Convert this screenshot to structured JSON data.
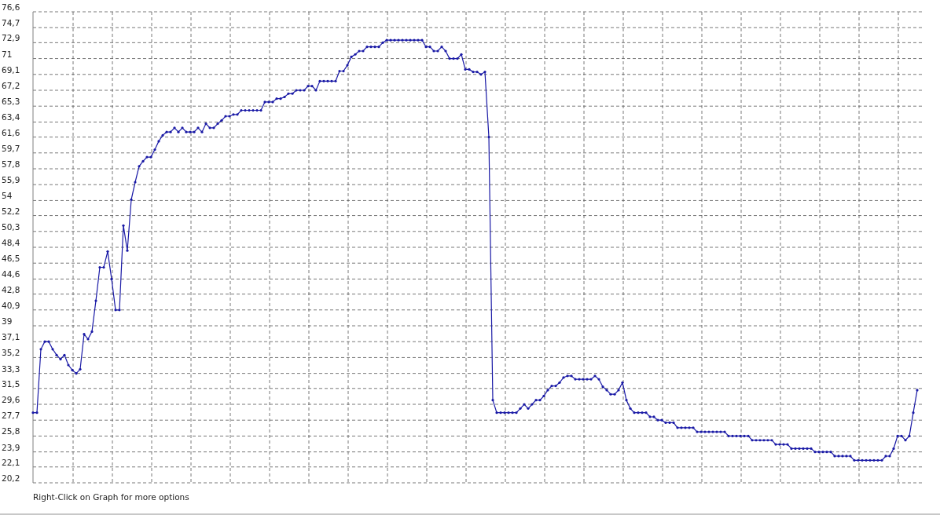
{
  "graph": {
    "chart_data": {
      "type": "line",
      "grid": true,
      "ylim": [
        20.2,
        76.6
      ],
      "yticks": [
        {
          "value": 76.6,
          "label": "76,6"
        },
        {
          "value": 74.7,
          "label": "74,7"
        },
        {
          "value": 72.9,
          "label": "72,9"
        },
        {
          "value": 71,
          "label": "71"
        },
        {
          "value": 69.1,
          "label": "69,1"
        },
        {
          "value": 67.2,
          "label": "67,2"
        },
        {
          "value": 65.3,
          "label": "65,3"
        },
        {
          "value": 63.4,
          "label": "63,4"
        },
        {
          "value": 61.6,
          "label": "61,6"
        },
        {
          "value": 59.7,
          "label": "59,7"
        },
        {
          "value": 57.8,
          "label": "57,8"
        },
        {
          "value": 55.9,
          "label": "55,9"
        },
        {
          "value": 54,
          "label": "54"
        },
        {
          "value": 52.2,
          "label": "52,2"
        },
        {
          "value": 50.3,
          "label": "50,3"
        },
        {
          "value": 48.4,
          "label": "48,4"
        },
        {
          "value": 46.5,
          "label": "46,5"
        },
        {
          "value": 44.6,
          "label": "44,6"
        },
        {
          "value": 42.8,
          "label": "42,8"
        },
        {
          "value": 40.9,
          "label": "40,9"
        },
        {
          "value": 39,
          "label": "39"
        },
        {
          "value": 37.1,
          "label": "37,1"
        },
        {
          "value": 35.2,
          "label": "35,2"
        },
        {
          "value": 33.3,
          "label": "33,3"
        },
        {
          "value": 31.5,
          "label": "31,5"
        },
        {
          "value": 29.6,
          "label": "29,6"
        },
        {
          "value": 27.7,
          "label": "27,7"
        },
        {
          "value": 25.8,
          "label": "25,8"
        },
        {
          "value": 23.9,
          "label": "23,9"
        },
        {
          "value": 22.1,
          "label": "22,1"
        },
        {
          "value": 20.2,
          "label": "20,2"
        }
      ],
      "series": [
        {
          "color": "#1a1aa6",
          "values": [
            28.6,
            28.6,
            36.2,
            37.1,
            37.1,
            36.2,
            35.5,
            35.0,
            35.5,
            34.3,
            33.7,
            33.3,
            33.8,
            38.0,
            37.4,
            38.3,
            42.0,
            46.0,
            46.0,
            47.9,
            44.6,
            40.9,
            40.9,
            51.0,
            48.0,
            54.1,
            56.2,
            58.1,
            58.7,
            59.2,
            59.2,
            60.1,
            61.1,
            61.8,
            62.2,
            62.2,
            62.7,
            62.2,
            62.7,
            62.2,
            62.2,
            62.2,
            62.7,
            62.2,
            63.2,
            62.7,
            62.7,
            63.2,
            63.6,
            64.1,
            64.1,
            64.3,
            64.3,
            64.8,
            64.8,
            64.8,
            64.8,
            64.8,
            64.8,
            65.8,
            65.8,
            65.8,
            66.2,
            66.2,
            66.4,
            66.8,
            66.8,
            67.2,
            67.2,
            67.2,
            67.7,
            67.7,
            67.2,
            68.3,
            68.3,
            68.3,
            68.3,
            68.3,
            69.5,
            69.5,
            70.2,
            71.2,
            71.5,
            71.9,
            71.9,
            72.4,
            72.4,
            72.4,
            72.4,
            72.9,
            73.2,
            73.2,
            73.2,
            73.2,
            73.2,
            73.2,
            73.2,
            73.2,
            73.2,
            73.2,
            72.4,
            72.4,
            71.9,
            71.9,
            72.4,
            71.9,
            71.0,
            71.0,
            71.0,
            71.5,
            69.7,
            69.7,
            69.4,
            69.4,
            69.1,
            69.4,
            61.6,
            30.1,
            28.6,
            28.6,
            28.6,
            28.6,
            28.6,
            28.6,
            29.1,
            29.6,
            29.1,
            29.6,
            30.1,
            30.1,
            30.6,
            31.3,
            31.8,
            31.8,
            32.2,
            32.8,
            33.0,
            33.0,
            32.6,
            32.6,
            32.6,
            32.6,
            32.6,
            33.0,
            32.6,
            31.7,
            31.3,
            30.8,
            30.8,
            31.3,
            32.2,
            30.1,
            29.1,
            28.6,
            28.6,
            28.6,
            28.6,
            28.1,
            28.1,
            27.7,
            27.7,
            27.4,
            27.4,
            27.4,
            26.8,
            26.8,
            26.8,
            26.8,
            26.8,
            26.3,
            26.3,
            26.3,
            26.3,
            26.3,
            26.3,
            26.3,
            26.3,
            25.8,
            25.8,
            25.8,
            25.8,
            25.8,
            25.8,
            25.3,
            25.3,
            25.3,
            25.3,
            25.3,
            25.3,
            24.8,
            24.8,
            24.8,
            24.8,
            24.3,
            24.3,
            24.3,
            24.3,
            24.3,
            24.3,
            23.9,
            23.9,
            23.9,
            23.9,
            23.9,
            23.4,
            23.4,
            23.4,
            23.4,
            23.4,
            22.9,
            22.9,
            22.9,
            22.9,
            22.9,
            22.9,
            22.9,
            22.9,
            23.4,
            23.4,
            24.3,
            25.8,
            25.8,
            25.3,
            25.8,
            28.6,
            31.3
          ]
        }
      ]
    }
  },
  "footer_hint": "Right-Click on Graph for more options"
}
